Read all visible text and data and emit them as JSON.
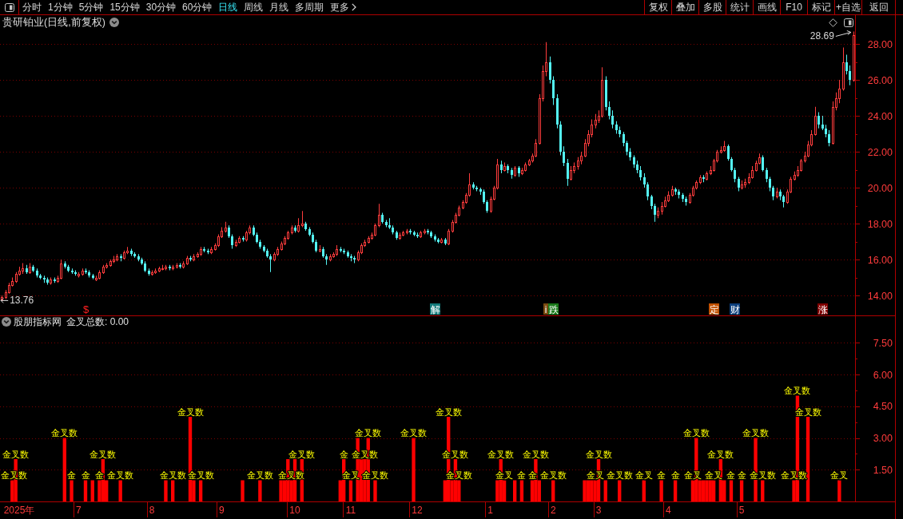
{
  "toolbar": {
    "periods": [
      {
        "label": "分时",
        "selected": false,
        "kind": "period"
      },
      {
        "label": "1分钟",
        "selected": false,
        "kind": "period"
      },
      {
        "label": "5分钟",
        "selected": false,
        "kind": "period"
      },
      {
        "label": "15分钟",
        "selected": false,
        "kind": "period"
      },
      {
        "label": "30分钟",
        "selected": false,
        "kind": "period"
      },
      {
        "label": "60分钟",
        "selected": false,
        "kind": "period"
      },
      {
        "label": "日线",
        "selected": true,
        "kind": "period"
      },
      {
        "label": "周线",
        "selected": false,
        "kind": "period"
      },
      {
        "label": "月线",
        "selected": false,
        "kind": "period"
      },
      {
        "label": "多周期",
        "selected": false,
        "kind": "period"
      },
      {
        "label": "更多",
        "selected": false,
        "kind": "menu"
      }
    ],
    "buttons": [
      "复权",
      "叠加",
      "多股",
      "统计",
      "画线",
      "F10",
      "标记",
      "+自选",
      "返回"
    ]
  },
  "price_pane": {
    "title": "贵研铂业(日线,前复权)",
    "high_label": "28.69",
    "low_label": "13.76",
    "events": [
      {
        "text": "$",
        "kind": "plain",
        "color": "#ff2020"
      },
      {
        "text": "解",
        "kind": "tag",
        "color": "#137a7a"
      },
      {
        "text": "i",
        "kind": "small_tag",
        "color": "#7a4a10"
      },
      {
        "text": "跌",
        "kind": "tag",
        "color": "#1a7a1a"
      },
      {
        "text": "定",
        "kind": "tag",
        "color": "#c05000"
      },
      {
        "text": "财",
        "kind": "tag",
        "color": "#0c3f7c"
      },
      {
        "text": "涨",
        "kind": "tag",
        "color": "#800000"
      }
    ],
    "chart_data": [
      {
        "type": "candlestick",
        "ylim": [
          12.89,
          28.8
        ],
        "grid": true,
        "yticks": [
          {
            "value": 14,
            "label": "14.00"
          },
          {
            "value": 16,
            "label": "16.00"
          },
          {
            "value": 18,
            "label": "18.00"
          },
          {
            "value": 20,
            "label": "20.00"
          },
          {
            "value": 22,
            "label": "22.00"
          },
          {
            "value": 24,
            "label": "24.00"
          },
          {
            "value": 26,
            "label": "26.00"
          },
          {
            "value": 28,
            "label": "28.00"
          }
        ],
        "ohlc": [
          [
            13.8,
            14.0,
            13.76,
            13.9
          ],
          [
            13.9,
            14.3,
            13.8,
            14.2
          ],
          [
            14.2,
            14.7,
            14.1,
            14.6
          ],
          [
            14.6,
            15.0,
            14.5,
            14.8
          ],
          [
            14.8,
            15.3,
            14.7,
            15.2
          ],
          [
            15.2,
            15.6,
            15.1,
            15.4
          ],
          [
            15.4,
            15.8,
            15.2,
            15.5
          ],
          [
            15.5,
            15.7,
            15.2,
            15.3
          ],
          [
            15.3,
            15.8,
            15.2,
            15.6
          ],
          [
            15.6,
            15.7,
            15.3,
            15.4
          ],
          [
            15.4,
            15.5,
            15.0,
            15.1
          ],
          [
            15.1,
            15.2,
            14.9,
            15.0
          ],
          [
            15.0,
            15.1,
            14.7,
            14.9
          ],
          [
            14.9,
            15.0,
            14.6,
            14.7
          ],
          [
            14.7,
            15.0,
            14.6,
            14.9
          ],
          [
            14.9,
            15.0,
            14.7,
            14.8
          ],
          [
            14.8,
            15.1,
            14.7,
            15.0
          ],
          [
            15.0,
            16.0,
            14.9,
            15.8
          ],
          [
            15.8,
            15.9,
            15.5,
            15.6
          ],
          [
            15.6,
            15.7,
            15.3,
            15.4
          ],
          [
            15.4,
            15.5,
            15.2,
            15.3
          ],
          [
            15.3,
            15.4,
            15.1,
            15.2
          ],
          [
            15.1,
            15.3,
            15.0,
            15.2
          ],
          [
            15.2,
            15.5,
            15.1,
            15.4
          ],
          [
            15.4,
            15.5,
            15.2,
            15.3
          ],
          [
            15.3,
            15.4,
            15.0,
            15.1
          ],
          [
            15.1,
            15.2,
            14.9,
            15.0
          ],
          [
            14.9,
            15.1,
            14.8,
            15.0
          ],
          [
            15.0,
            15.4,
            14.9,
            15.3
          ],
          [
            15.3,
            15.7,
            15.2,
            15.6
          ],
          [
            15.6,
            15.8,
            15.5,
            15.7
          ],
          [
            15.7,
            16.0,
            15.6,
            15.9
          ],
          [
            15.9,
            16.2,
            15.8,
            16.0
          ],
          [
            16.0,
            16.3,
            15.9,
            16.2
          ],
          [
            16.2,
            16.3,
            15.9,
            16.1
          ],
          [
            16.1,
            16.5,
            16.0,
            16.4
          ],
          [
            16.4,
            16.7,
            16.3,
            16.5
          ],
          [
            16.5,
            16.6,
            16.2,
            16.3
          ],
          [
            16.3,
            16.4,
            16.1,
            16.2
          ],
          [
            16.2,
            16.3,
            15.9,
            16.0
          ],
          [
            16.0,
            16.1,
            15.7,
            15.8
          ],
          [
            15.8,
            15.9,
            15.3,
            15.4
          ],
          [
            15.4,
            15.5,
            15.1,
            15.2
          ],
          [
            15.2,
            15.4,
            15.1,
            15.3
          ],
          [
            15.3,
            15.5,
            15.2,
            15.4
          ],
          [
            15.4,
            15.6,
            15.3,
            15.5
          ],
          [
            15.5,
            15.7,
            15.4,
            15.5
          ],
          [
            15.5,
            15.7,
            15.4,
            15.6
          ],
          [
            15.6,
            15.7,
            15.4,
            15.5
          ],
          [
            15.5,
            15.7,
            15.4,
            15.6
          ],
          [
            15.6,
            15.8,
            15.5,
            15.7
          ],
          [
            15.7,
            15.8,
            15.5,
            15.6
          ],
          [
            15.6,
            15.9,
            15.5,
            15.8
          ],
          [
            15.8,
            16.2,
            15.7,
            16.1
          ],
          [
            16.1,
            16.2,
            15.9,
            16.0
          ],
          [
            16.0,
            16.3,
            15.9,
            16.2
          ],
          [
            16.2,
            16.4,
            16.1,
            16.3
          ],
          [
            16.3,
            16.7,
            16.2,
            16.6
          ],
          [
            16.6,
            16.7,
            16.4,
            16.5
          ],
          [
            16.5,
            16.6,
            16.3,
            16.4
          ],
          [
            16.4,
            16.7,
            16.3,
            16.6
          ],
          [
            16.6,
            16.9,
            16.5,
            16.8
          ],
          [
            16.8,
            17.4,
            16.7,
            17.3
          ],
          [
            17.3,
            17.8,
            17.2,
            17.6
          ],
          [
            17.6,
            18.1,
            17.5,
            17.8
          ],
          [
            17.8,
            17.9,
            17.2,
            17.3
          ],
          [
            17.3,
            17.4,
            16.6,
            16.8
          ],
          [
            16.8,
            17.1,
            16.7,
            17.0
          ],
          [
            17.0,
            17.3,
            16.9,
            17.2
          ],
          [
            17.2,
            17.3,
            17.0,
            17.1
          ],
          [
            17.1,
            17.6,
            17.0,
            17.5
          ],
          [
            17.5,
            17.9,
            17.4,
            17.8
          ],
          [
            17.8,
            17.9,
            17.3,
            17.4
          ],
          [
            17.4,
            17.5,
            16.9,
            17.0
          ],
          [
            17.0,
            17.1,
            16.6,
            16.7
          ],
          [
            16.7,
            16.8,
            16.4,
            16.5
          ],
          [
            16.5,
            16.6,
            16.1,
            16.2
          ],
          [
            16.2,
            16.3,
            15.3,
            16.0
          ],
          [
            16.0,
            16.4,
            15.9,
            16.3
          ],
          [
            16.3,
            16.7,
            16.2,
            16.6
          ],
          [
            16.6,
            17.0,
            16.5,
            16.9
          ],
          [
            16.9,
            17.3,
            16.8,
            17.2
          ],
          [
            17.2,
            17.6,
            17.1,
            17.5
          ],
          [
            17.5,
            17.9,
            17.4,
            17.8
          ],
          [
            17.8,
            17.9,
            17.5,
            17.6
          ],
          [
            17.6,
            18.3,
            17.5,
            17.9
          ],
          [
            17.9,
            18.7,
            17.8,
            18.0
          ],
          [
            18.0,
            18.1,
            17.6,
            17.7
          ],
          [
            17.7,
            17.8,
            17.3,
            17.4
          ],
          [
            17.4,
            17.5,
            16.9,
            17.0
          ],
          [
            17.0,
            17.1,
            16.4,
            16.5
          ],
          [
            16.5,
            16.8,
            16.4,
            16.6
          ],
          [
            16.6,
            16.7,
            16.1,
            16.2
          ],
          [
            16.2,
            16.3,
            15.7,
            16.0
          ],
          [
            16.0,
            16.3,
            15.9,
            16.2
          ],
          [
            16.2,
            16.4,
            16.1,
            16.3
          ],
          [
            16.3,
            16.8,
            16.2,
            16.6
          ],
          [
            16.6,
            16.7,
            16.4,
            16.5
          ],
          [
            16.5,
            16.6,
            16.3,
            16.4
          ],
          [
            16.4,
            16.5,
            16.1,
            16.2
          ],
          [
            16.2,
            16.3,
            15.9,
            16.1
          ],
          [
            16.1,
            16.2,
            15.8,
            16.0
          ],
          [
            16.0,
            16.5,
            15.9,
            16.4
          ],
          [
            16.4,
            16.9,
            16.3,
            16.8
          ],
          [
            16.8,
            17.1,
            16.7,
            17.0
          ],
          [
            17.0,
            17.3,
            16.9,
            17.2
          ],
          [
            17.2,
            17.5,
            17.1,
            17.4
          ],
          [
            17.4,
            18.0,
            17.3,
            17.9
          ],
          [
            17.9,
            19.1,
            17.8,
            18.5
          ],
          [
            18.5,
            18.6,
            18.0,
            18.1
          ],
          [
            18.1,
            18.2,
            17.8,
            17.9
          ],
          [
            17.9,
            18.3,
            17.7,
            17.8
          ],
          [
            17.8,
            17.9,
            17.4,
            17.5
          ],
          [
            17.5,
            17.6,
            17.1,
            17.2
          ],
          [
            17.2,
            17.5,
            17.1,
            17.4
          ],
          [
            17.4,
            17.6,
            17.3,
            17.5
          ],
          [
            17.5,
            17.7,
            17.4,
            17.6
          ],
          [
            17.6,
            17.7,
            17.4,
            17.5
          ],
          [
            17.5,
            17.6,
            17.3,
            17.4
          ],
          [
            17.4,
            17.5,
            17.2,
            17.3
          ],
          [
            17.3,
            17.6,
            17.2,
            17.5
          ],
          [
            17.5,
            17.7,
            17.4,
            17.6
          ],
          [
            17.6,
            17.7,
            17.4,
            17.5
          ],
          [
            17.5,
            17.6,
            17.2,
            17.3
          ],
          [
            17.3,
            17.4,
            17.0,
            17.1
          ],
          [
            17.1,
            17.2,
            16.9,
            17.0
          ],
          [
            17.0,
            17.2,
            16.9,
            17.1
          ],
          [
            17.1,
            17.2,
            16.8,
            16.9
          ],
          [
            16.9,
            17.7,
            16.8,
            17.6
          ],
          [
            17.6,
            18.2,
            17.5,
            18.1
          ],
          [
            18.1,
            18.6,
            18.0,
            18.5
          ],
          [
            18.5,
            19.0,
            18.4,
            18.9
          ],
          [
            18.9,
            19.3,
            18.8,
            19.2
          ],
          [
            19.2,
            19.7,
            19.1,
            19.6
          ],
          [
            19.6,
            20.8,
            19.5,
            20.2
          ],
          [
            20.2,
            20.3,
            19.9,
            20.0
          ],
          [
            20.0,
            20.1,
            19.8,
            19.9
          ],
          [
            19.9,
            20.0,
            19.6,
            19.8
          ],
          [
            19.8,
            19.9,
            19.1,
            19.2
          ],
          [
            19.2,
            19.3,
            18.6,
            18.7
          ],
          [
            18.7,
            19.5,
            18.6,
            19.4
          ],
          [
            19.4,
            20.1,
            19.3,
            20.0
          ],
          [
            20.0,
            21.6,
            19.9,
            21.3
          ],
          [
            21.3,
            21.5,
            20.8,
            21.0
          ],
          [
            21.0,
            21.4,
            20.9,
            21.2
          ],
          [
            21.2,
            21.3,
            20.8,
            21.0
          ],
          [
            21.0,
            21.1,
            20.5,
            20.7
          ],
          [
            20.7,
            21.2,
            20.6,
            21.1
          ],
          [
            21.1,
            21.2,
            20.6,
            20.8
          ],
          [
            20.8,
            21.1,
            20.7,
            21.0
          ],
          [
            21.0,
            21.4,
            20.9,
            21.3
          ],
          [
            21.3,
            21.6,
            21.2,
            21.5
          ],
          [
            21.5,
            21.9,
            21.4,
            21.8
          ],
          [
            21.8,
            22.7,
            21.7,
            22.5
          ],
          [
            22.5,
            25.2,
            22.4,
            25.0
          ],
          [
            25.0,
            26.8,
            24.8,
            26.5
          ],
          [
            26.5,
            28.1,
            26.2,
            27.0
          ],
          [
            27.0,
            27.3,
            25.8,
            26.0
          ],
          [
            26.0,
            26.2,
            24.6,
            25.0
          ],
          [
            25.0,
            25.2,
            23.3,
            23.5
          ],
          [
            23.5,
            23.7,
            21.8,
            22.0
          ],
          [
            22.0,
            22.3,
            21.2,
            21.4
          ],
          [
            21.4,
            21.6,
            20.1,
            20.5
          ],
          [
            20.5,
            21.2,
            20.4,
            21.0
          ],
          [
            21.0,
            21.4,
            20.8,
            21.2
          ],
          [
            21.2,
            21.7,
            21.0,
            21.5
          ],
          [
            21.5,
            22.0,
            21.3,
            21.8
          ],
          [
            21.8,
            22.7,
            21.7,
            22.5
          ],
          [
            22.5,
            23.2,
            22.3,
            23.0
          ],
          [
            23.0,
            23.8,
            22.8,
            23.5
          ],
          [
            23.5,
            24.1,
            23.3,
            23.8
          ],
          [
            23.8,
            24.3,
            23.6,
            24.0
          ],
          [
            24.0,
            26.7,
            23.9,
            26.0
          ],
          [
            26.0,
            26.2,
            24.3,
            24.5
          ],
          [
            24.5,
            24.8,
            23.8,
            24.0
          ],
          [
            24.0,
            24.3,
            23.3,
            23.5
          ],
          [
            23.5,
            23.7,
            23.0,
            23.2
          ],
          [
            23.2,
            23.4,
            22.8,
            23.0
          ],
          [
            23.0,
            23.1,
            22.3,
            22.5
          ],
          [
            22.5,
            22.6,
            21.8,
            22.0
          ],
          [
            22.0,
            22.2,
            21.5,
            21.7
          ],
          [
            21.7,
            21.8,
            21.1,
            21.3
          ],
          [
            21.3,
            21.5,
            20.8,
            21.0
          ],
          [
            21.0,
            21.2,
            20.4,
            20.6
          ],
          [
            20.6,
            20.8,
            20.0,
            20.2
          ],
          [
            20.2,
            20.3,
            19.3,
            19.5
          ],
          [
            19.5,
            19.6,
            18.8,
            19.0
          ],
          [
            19.0,
            19.1,
            18.1,
            18.5
          ],
          [
            18.5,
            18.9,
            18.3,
            18.7
          ],
          [
            18.7,
            19.2,
            18.5,
            19.0
          ],
          [
            19.0,
            19.5,
            18.9,
            19.3
          ],
          [
            19.3,
            19.8,
            19.2,
            19.6
          ],
          [
            19.6,
            20.1,
            19.5,
            19.9
          ],
          [
            19.9,
            20.0,
            19.6,
            19.8
          ],
          [
            19.8,
            19.9,
            19.4,
            19.6
          ],
          [
            19.6,
            19.7,
            19.2,
            19.4
          ],
          [
            19.4,
            19.5,
            19.0,
            19.2
          ],
          [
            19.2,
            19.7,
            19.1,
            19.6
          ],
          [
            19.6,
            20.1,
            19.5,
            20.0
          ],
          [
            20.0,
            20.4,
            19.9,
            20.3
          ],
          [
            20.3,
            20.7,
            20.2,
            20.6
          ],
          [
            20.6,
            20.7,
            20.3,
            20.5
          ],
          [
            20.5,
            20.9,
            20.4,
            20.8
          ],
          [
            20.8,
            21.2,
            20.7,
            21.0
          ],
          [
            21.0,
            21.6,
            20.9,
            21.5
          ],
          [
            21.5,
            22.1,
            21.4,
            22.0
          ],
          [
            22.0,
            22.3,
            21.9,
            22.1
          ],
          [
            22.1,
            22.6,
            22.0,
            22.3
          ],
          [
            22.3,
            22.4,
            21.5,
            21.6
          ],
          [
            21.6,
            21.7,
            20.9,
            21.0
          ],
          [
            21.0,
            21.1,
            20.3,
            20.5
          ],
          [
            20.5,
            20.6,
            19.8,
            20.0
          ],
          [
            20.0,
            20.4,
            19.9,
            20.2
          ],
          [
            20.2,
            20.5,
            20.0,
            20.3
          ],
          [
            20.3,
            20.8,
            20.2,
            20.6
          ],
          [
            20.6,
            21.2,
            20.5,
            21.0
          ],
          [
            21.0,
            21.5,
            20.9,
            21.4
          ],
          [
            21.4,
            21.9,
            21.3,
            21.7
          ],
          [
            21.7,
            21.8,
            20.9,
            21.0
          ],
          [
            21.0,
            21.1,
            20.3,
            20.5
          ],
          [
            20.5,
            20.6,
            19.8,
            20.0
          ],
          [
            20.0,
            20.1,
            19.3,
            19.5
          ],
          [
            19.5,
            20.0,
            19.4,
            19.8
          ],
          [
            19.8,
            19.9,
            19.3,
            19.5
          ],
          [
            19.5,
            19.6,
            18.9,
            19.2
          ],
          [
            19.2,
            19.9,
            19.1,
            19.8
          ],
          [
            19.8,
            20.6,
            19.7,
            20.5
          ],
          [
            20.5,
            20.9,
            20.4,
            20.7
          ],
          [
            20.7,
            21.2,
            20.6,
            21.0
          ],
          [
            21.0,
            21.6,
            20.9,
            21.5
          ],
          [
            21.5,
            22.0,
            21.4,
            21.8
          ],
          [
            21.8,
            22.6,
            21.7,
            22.4
          ],
          [
            22.4,
            23.2,
            22.3,
            23.0
          ],
          [
            23.0,
            24.5,
            22.9,
            24.0
          ],
          [
            24.0,
            24.2,
            23.3,
            23.5
          ],
          [
            23.5,
            24.0,
            23.2,
            23.3
          ],
          [
            23.3,
            23.5,
            22.8,
            23.0
          ],
          [
            23.0,
            23.2,
            22.3,
            22.5
          ],
          [
            22.5,
            24.8,
            22.4,
            24.5
          ],
          [
            24.5,
            25.3,
            24.3,
            25.0
          ],
          [
            25.0,
            26.0,
            24.7,
            25.5
          ],
          [
            25.5,
            27.8,
            25.4,
            27.0
          ],
          [
            27.0,
            27.4,
            26.3,
            26.5
          ],
          [
            26.5,
            26.8,
            25.7,
            26.0
          ],
          [
            26.0,
            28.69,
            25.9,
            28.5
          ]
        ]
      }
    ]
  },
  "indicator_pane": {
    "name": "股朋指标网",
    "reading": "金叉总数: 0.00",
    "chart_data": [
      {
        "type": "bar",
        "color": "#ff0000",
        "ylim": [
          0,
          8.23
        ],
        "grid": true,
        "yticks": [
          {
            "value": 1.5,
            "label": "1.50"
          },
          {
            "value": 3,
            "label": "3.00"
          },
          {
            "value": 4.5,
            "label": "4.50"
          },
          {
            "value": 6,
            "label": "6.00"
          },
          {
            "value": 7.5,
            "label": "7.50"
          }
        ],
        "categories": [
          null,
          null,
          null,
          null,
          null,
          "2025年",
          null,
          null,
          null,
          null,
          null,
          null,
          null,
          null,
          null,
          null,
          null,
          null,
          null,
          null,
          null,
          null,
          "7",
          null,
          null,
          null,
          null,
          null,
          null,
          null,
          null,
          null,
          null,
          null,
          null,
          null,
          null,
          null,
          null,
          null,
          null,
          null,
          null,
          "8",
          null,
          null,
          null,
          null,
          null,
          null,
          null,
          null,
          null,
          null,
          null,
          null,
          null,
          null,
          null,
          null,
          null,
          null,
          null,
          "9",
          null,
          null,
          null,
          null,
          null,
          null,
          null,
          null,
          null,
          null,
          null,
          null,
          null,
          null,
          null,
          null,
          null,
          null,
          null,
          null,
          "10",
          null,
          null,
          null,
          null,
          null,
          null,
          null,
          null,
          null,
          null,
          null,
          null,
          null,
          null,
          null,
          "11",
          null,
          null,
          null,
          null,
          null,
          null,
          null,
          null,
          null,
          null,
          null,
          null,
          null,
          null,
          null,
          null,
          null,
          null,
          "12",
          null,
          null,
          null,
          null,
          null,
          null,
          null,
          null,
          null,
          null,
          null,
          null,
          null,
          null,
          null,
          null,
          null,
          null,
          null,
          null,
          "1",
          null,
          null,
          null,
          null,
          null,
          null,
          null,
          null,
          null,
          null,
          null,
          null,
          null,
          null,
          null,
          null,
          null,
          "2",
          null,
          null,
          null,
          null,
          null,
          null,
          null,
          null,
          null,
          null,
          null,
          null,
          "3",
          null,
          null,
          null,
          null,
          null,
          null,
          null,
          null,
          null,
          null,
          null,
          null,
          null,
          null,
          null,
          null,
          null,
          null,
          null,
          "4",
          null,
          null,
          null,
          null,
          null,
          null,
          null,
          null,
          null,
          null,
          null,
          null,
          null,
          null,
          null,
          null,
          null,
          null,
          null,
          null,
          "5",
          null,
          null,
          null,
          null,
          null,
          null,
          null,
          null,
          null,
          null,
          null,
          null,
          null,
          null,
          null,
          null,
          null,
          null,
          null,
          null,
          null,
          null,
          null,
          null,
          null,
          null,
          null,
          null,
          null,
          null,
          null,
          null
        ],
        "values": [
          0,
          0,
          0,
          1,
          2,
          0,
          0,
          0,
          0,
          0,
          0,
          0,
          0,
          0,
          0,
          0,
          0,
          0,
          3,
          0,
          1,
          0,
          0,
          0,
          1,
          0,
          1,
          0,
          1,
          2,
          1,
          0,
          0,
          0,
          1,
          0,
          0,
          0,
          0,
          0,
          0,
          0,
          0,
          0,
          0,
          0,
          0,
          1,
          0,
          1,
          0,
          0,
          0,
          0,
          4,
          1,
          0,
          1,
          0,
          0,
          0,
          0,
          0,
          0,
          0,
          0,
          0,
          0,
          0,
          1,
          0,
          0,
          0,
          0,
          1,
          0,
          0,
          0,
          0,
          0,
          1,
          1,
          2,
          1,
          2,
          0,
          2,
          0,
          0,
          0,
          0,
          0,
          0,
          0,
          0,
          0,
          0,
          1,
          2,
          0,
          1,
          0,
          3,
          2,
          2,
          3,
          0,
          1,
          0,
          0,
          0,
          0,
          0,
          0,
          0,
          0,
          0,
          0,
          3,
          0,
          0,
          0,
          0,
          0,
          0,
          0,
          0,
          1,
          4,
          1,
          2,
          1,
          0,
          0,
          0,
          0,
          0,
          0,
          0,
          0,
          0,
          0,
          1,
          2,
          1,
          0,
          0,
          1,
          0,
          1,
          0,
          0,
          1,
          2,
          1,
          0,
          0,
          0,
          1,
          0,
          0,
          0,
          0,
          0,
          0,
          0,
          0,
          1,
          1,
          1,
          1,
          2,
          0,
          1,
          0,
          0,
          0,
          1,
          0,
          0,
          0,
          0,
          0,
          0,
          1,
          0,
          0,
          0,
          0,
          1,
          0,
          0,
          0,
          1,
          0,
          0,
          0,
          0,
          1,
          3,
          1,
          1,
          1,
          1,
          1,
          0,
          2,
          1,
          0,
          1,
          0,
          0,
          1,
          0,
          0,
          0,
          3,
          0,
          1,
          0,
          0,
          0,
          0,
          0,
          0,
          0,
          0,
          1,
          5,
          0,
          0,
          4,
          0,
          0,
          0,
          0,
          0,
          0,
          0,
          0,
          1,
          0,
          0,
          0,
          0
        ],
        "value_labels": [
          null,
          null,
          null,
          "金叉数",
          "金叉数",
          null,
          null,
          null,
          null,
          null,
          null,
          null,
          null,
          null,
          null,
          null,
          null,
          null,
          "金叉数",
          null,
          "金",
          null,
          null,
          null,
          "金",
          null,
          null,
          null,
          "金",
          "金叉数",
          null,
          null,
          null,
          null,
          "金叉数",
          null,
          null,
          null,
          null,
          null,
          null,
          null,
          null,
          null,
          null,
          null,
          null,
          null,
          null,
          "金叉数",
          null,
          null,
          null,
          null,
          "金叉数",
          null,
          null,
          "金叉数",
          null,
          null,
          null,
          null,
          null,
          null,
          null,
          null,
          null,
          null,
          null,
          null,
          null,
          null,
          null,
          null,
          "金叉数",
          null,
          null,
          null,
          null,
          null,
          null,
          null,
          null,
          "金叉数",
          null,
          null,
          "金叉数",
          null,
          null,
          null,
          null,
          null,
          null,
          null,
          null,
          null,
          null,
          null,
          "金",
          null,
          "金叉",
          null,
          null,
          null,
          "金叉数",
          "金叉数",
          null,
          "金叉数",
          null,
          null,
          null,
          null,
          null,
          null,
          null,
          null,
          null,
          null,
          "金叉数",
          null,
          null,
          null,
          null,
          null,
          null,
          null,
          null,
          null,
          "金叉数",
          null,
          "金叉数",
          "金叉数",
          null,
          null,
          null,
          null,
          null,
          null,
          null,
          null,
          null,
          null,
          null,
          "金叉数",
          "金叉",
          null,
          null,
          null,
          null,
          "金",
          null,
          null,
          "金",
          "金叉数",
          null,
          null,
          null,
          null,
          "金叉数",
          null,
          null,
          null,
          null,
          null,
          null,
          null,
          null,
          null,
          null,
          null,
          "金叉",
          "金叉数",
          null,
          null,
          null,
          null,
          null,
          "金叉数",
          null,
          null,
          null,
          null,
          null,
          null,
          "金叉",
          null,
          null,
          null,
          null,
          "金",
          null,
          null,
          null,
          "金",
          null,
          null,
          null,
          null,
          "金叉",
          "金叉数",
          null,
          null,
          null,
          null,
          "金叉",
          null,
          "金叉数",
          null,
          null,
          "金",
          null,
          null,
          "金",
          null,
          null,
          null,
          "金叉数",
          null,
          "金叉数",
          null,
          null,
          null,
          null,
          null,
          null,
          null,
          null,
          "金叉数",
          "金叉数",
          null,
          null,
          "金叉数",
          null,
          null,
          null,
          null,
          null,
          null,
          null,
          null,
          "金叉",
          null,
          null,
          null,
          null
        ]
      }
    ]
  }
}
